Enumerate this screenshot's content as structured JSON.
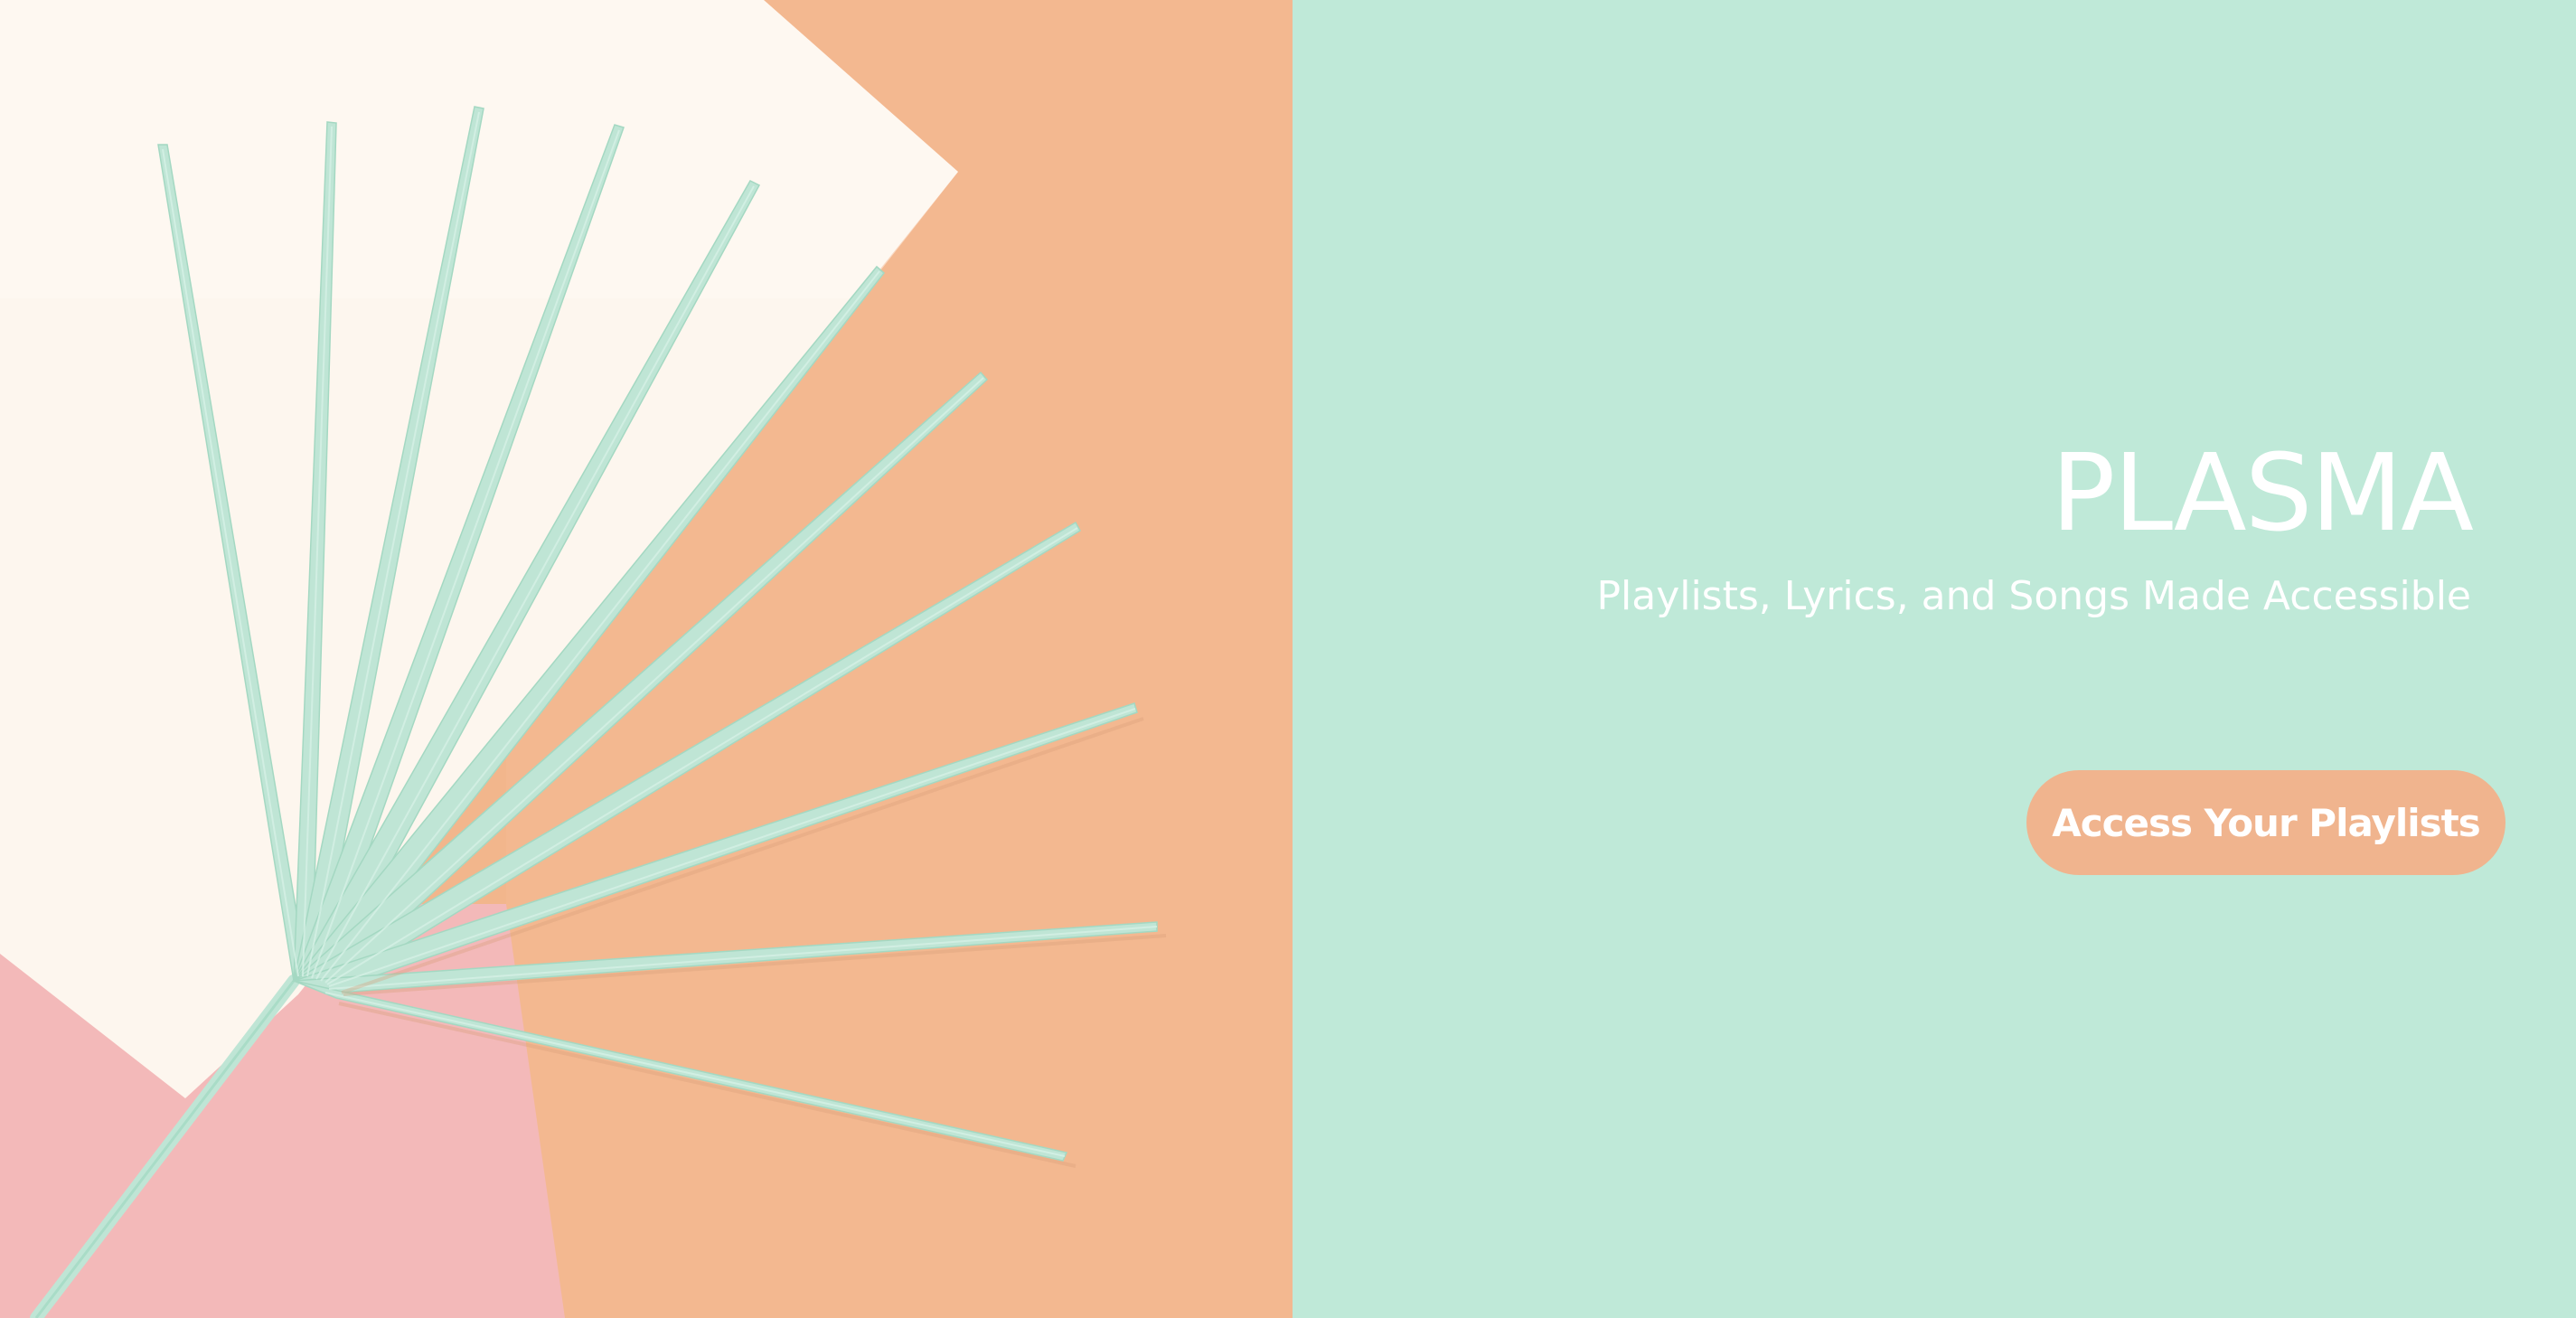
{
  "hero": {
    "title": "PLASMA",
    "tagline": "Playlists, Lyrics, and Songs Made Accessible",
    "cta_label": "Access Your Playlists"
  },
  "colors": {
    "panel_background": "#bfe9d8",
    "button_background": "#f0b48e",
    "text": "#ffffff",
    "image_peach": "#f2b68c",
    "image_cream": "#fdf6ee",
    "image_pink": "#f2b8b7",
    "image_leaf": "#bfe5d5"
  },
  "image": {
    "subject": "palm-leaf-on-paper-photo"
  }
}
